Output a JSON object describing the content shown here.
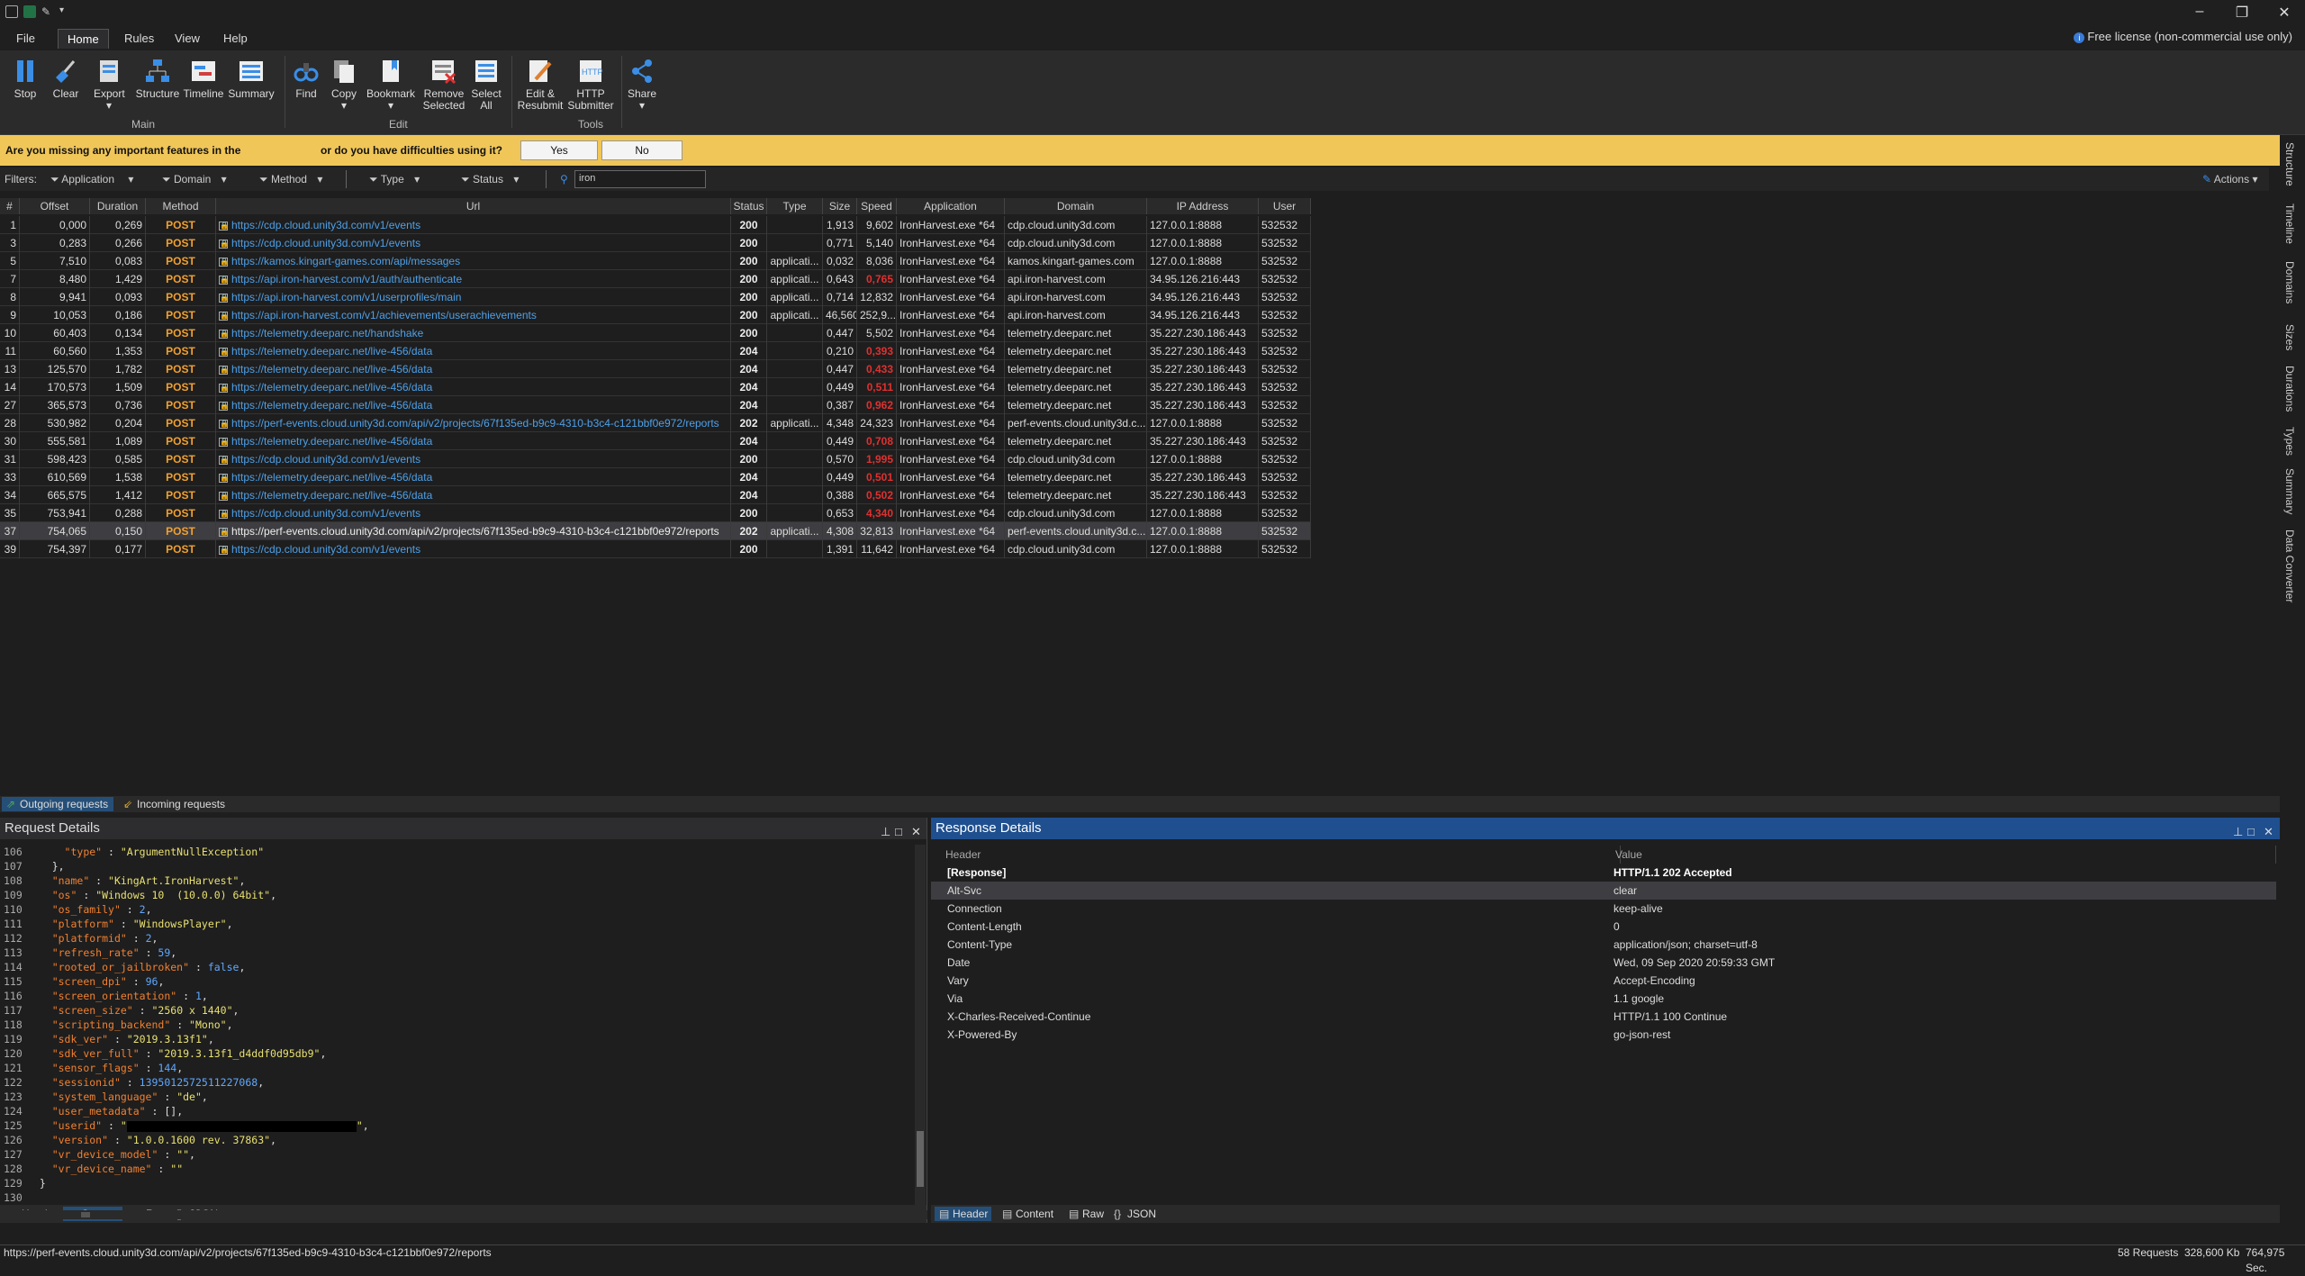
{
  "menu": {
    "file": "File",
    "home": "Home",
    "rules": "Rules",
    "view": "View",
    "help": "Help",
    "license": "Free license (non-commercial use only)"
  },
  "ribbon": {
    "stop": "Stop",
    "clear": "Clear",
    "export": "Export",
    "structure": "Structure",
    "timeline": "Timeline",
    "summary": "Summary",
    "find": "Find",
    "copy": "Copy",
    "bookmark": "Bookmark",
    "remove_selected_1": "Remove",
    "remove_selected_2": "Selected",
    "select_all_1": "Select",
    "select_all_2": "All",
    "edit_resubmit_1": "Edit &",
    "edit_resubmit_2": "Resubmit",
    "http_submitter_1": "HTTP",
    "http_submitter_2": "Submitter",
    "share": "Share",
    "group_main": "Main",
    "group_edit": "Edit",
    "group_tools": "Tools"
  },
  "banner": {
    "msg1": "Are you missing any important features in the",
    "msg2": "or do you have difficulties using it?",
    "yes": "Yes",
    "no": "No"
  },
  "filters": {
    "label": "Filters:",
    "application": "Application",
    "domain": "Domain",
    "method": "Method",
    "type": "Type",
    "status": "Status",
    "search_value": "iron",
    "actions": "Actions"
  },
  "grid": {
    "columns": [
      "#",
      "Offset",
      "Duration",
      "Method",
      "Url",
      "Status",
      "Type",
      "Size",
      "Speed",
      "Application",
      "Domain",
      "IP Address",
      "User"
    ],
    "rows": [
      [
        "1",
        "0,000",
        "0,269",
        "POST",
        "https://cdp.cloud.unity3d.com/v1/events",
        "200",
        "",
        "1,913",
        "9,602",
        "IronHarvest.exe *64",
        "cdp.cloud.unity3d.com",
        "127.0.0.1:8888",
        "532532"
      ],
      [
        "3",
        "0,283",
        "0,266",
        "POST",
        "https://cdp.cloud.unity3d.com/v1/events",
        "200",
        "",
        "0,771",
        "5,140",
        "IronHarvest.exe *64",
        "cdp.cloud.unity3d.com",
        "127.0.0.1:8888",
        "532532"
      ],
      [
        "5",
        "7,510",
        "0,083",
        "POST",
        "https://kamos.kingart-games.com/api/messages",
        "200",
        "applicati...",
        "0,032",
        "8,036",
        "IronHarvest.exe *64",
        "kamos.kingart-games.com",
        "127.0.0.1:8888",
        "532532"
      ],
      [
        "7",
        "8,480",
        "1,429",
        "POST",
        "https://api.iron-harvest.com/v1/auth/authenticate",
        "200",
        "applicati...",
        "0,643",
        "0,765",
        "IronHarvest.exe *64",
        "api.iron-harvest.com",
        "34.95.126.216:443",
        "532532"
      ],
      [
        "8",
        "9,941",
        "0,093",
        "POST",
        "https://api.iron-harvest.com/v1/userprofiles/main",
        "200",
        "applicati...",
        "0,714",
        "12,832",
        "IronHarvest.exe *64",
        "api.iron-harvest.com",
        "34.95.126.216:443",
        "532532"
      ],
      [
        "9",
        "10,053",
        "0,186",
        "POST",
        "https://api.iron-harvest.com/v1/achievements/userachievements",
        "200",
        "applicati...",
        "46,560",
        "252,9...",
        "IronHarvest.exe *64",
        "api.iron-harvest.com",
        "34.95.126.216:443",
        "532532"
      ],
      [
        "10",
        "60,403",
        "0,134",
        "POST",
        "https://telemetry.deeparc.net/handshake",
        "200",
        "",
        "0,447",
        "5,502",
        "IronHarvest.exe *64",
        "telemetry.deeparc.net",
        "35.227.230.186:443",
        "532532"
      ],
      [
        "11",
        "60,560",
        "1,353",
        "POST",
        "https://telemetry.deeparc.net/live-456/data",
        "204",
        "",
        "0,210",
        "0,393",
        "IronHarvest.exe *64",
        "telemetry.deeparc.net",
        "35.227.230.186:443",
        "532532"
      ],
      [
        "13",
        "125,570",
        "1,782",
        "POST",
        "https://telemetry.deeparc.net/live-456/data",
        "204",
        "",
        "0,447",
        "0,433",
        "IronHarvest.exe *64",
        "telemetry.deeparc.net",
        "35.227.230.186:443",
        "532532"
      ],
      [
        "14",
        "170,573",
        "1,509",
        "POST",
        "https://telemetry.deeparc.net/live-456/data",
        "204",
        "",
        "0,449",
        "0,511",
        "IronHarvest.exe *64",
        "telemetry.deeparc.net",
        "35.227.230.186:443",
        "532532"
      ],
      [
        "27",
        "365,573",
        "0,736",
        "POST",
        "https://telemetry.deeparc.net/live-456/data",
        "204",
        "",
        "0,387",
        "0,962",
        "IronHarvest.exe *64",
        "telemetry.deeparc.net",
        "35.227.230.186:443",
        "532532"
      ],
      [
        "28",
        "530,982",
        "0,204",
        "POST",
        "https://perf-events.cloud.unity3d.com/api/v2/projects/67f135ed-b9c9-4310-b3c4-c121bbf0e972/reports",
        "202",
        "applicati...",
        "4,348",
        "24,323",
        "IronHarvest.exe *64",
        "perf-events.cloud.unity3d.c...",
        "127.0.0.1:8888",
        "532532"
      ],
      [
        "30",
        "555,581",
        "1,089",
        "POST",
        "https://telemetry.deeparc.net/live-456/data",
        "204",
        "",
        "0,449",
        "0,708",
        "IronHarvest.exe *64",
        "telemetry.deeparc.net",
        "35.227.230.186:443",
        "532532"
      ],
      [
        "31",
        "598,423",
        "0,585",
        "POST",
        "https://cdp.cloud.unity3d.com/v1/events",
        "200",
        "",
        "0,570",
        "1,995",
        "IronHarvest.exe *64",
        "cdp.cloud.unity3d.com",
        "127.0.0.1:8888",
        "532532"
      ],
      [
        "33",
        "610,569",
        "1,538",
        "POST",
        "https://telemetry.deeparc.net/live-456/data",
        "204",
        "",
        "0,449",
        "0,501",
        "IronHarvest.exe *64",
        "telemetry.deeparc.net",
        "35.227.230.186:443",
        "532532"
      ],
      [
        "34",
        "665,575",
        "1,412",
        "POST",
        "https://telemetry.deeparc.net/live-456/data",
        "204",
        "",
        "0,388",
        "0,502",
        "IronHarvest.exe *64",
        "telemetry.deeparc.net",
        "35.227.230.186:443",
        "532532"
      ],
      [
        "35",
        "753,941",
        "0,288",
        "POST",
        "https://cdp.cloud.unity3d.com/v1/events",
        "200",
        "",
        "0,653",
        "4,340",
        "IronHarvest.exe *64",
        "cdp.cloud.unity3d.com",
        "127.0.0.1:8888",
        "532532"
      ],
      [
        "37",
        "754,065",
        "0,150",
        "POST",
        "https://perf-events.cloud.unity3d.com/api/v2/projects/67f135ed-b9c9-4310-b3c4-c121bbf0e972/reports",
        "202",
        "applicati...",
        "4,308",
        "32,813",
        "IronHarvest.exe *64",
        "perf-events.cloud.unity3d.c...",
        "127.0.0.1:8888",
        "532532"
      ],
      [
        "39",
        "754,397",
        "0,177",
        "POST",
        "https://cdp.cloud.unity3d.com/v1/events",
        "200",
        "",
        "1,391",
        "11,642",
        "IronHarvest.exe *64",
        "cdp.cloud.unity3d.com",
        "127.0.0.1:8888",
        "532532"
      ]
    ],
    "slow_rows": [
      3,
      7,
      8,
      9,
      10,
      12,
      13,
      14,
      15,
      16
    ],
    "selected_row": 17
  },
  "sidebar": [
    "Structure",
    "Timeline",
    "Domains",
    "Sizes",
    "Durations",
    "Types",
    "Summary",
    "Data Converter"
  ],
  "bottom_tabs": {
    "outgoing": "Outgoing requests",
    "incoming": "Incoming requests"
  },
  "request": {
    "title": "Request Details",
    "lines": [
      {
        "n": "106",
        "ind": "      ",
        "key": "\"type\"",
        "val": "\"ArgumentNullException\"",
        "t": "s",
        "tail": ""
      },
      {
        "n": "107",
        "ind": "    ",
        "raw": "},"
      },
      {
        "n": "108",
        "ind": "    ",
        "key": "\"name\"",
        "val": "\"KingArt.IronHarvest\"",
        "t": "s",
        "tail": ","
      },
      {
        "n": "109",
        "ind": "    ",
        "key": "\"os\"",
        "val": "\"Windows 10  (10.0.0) 64bit\"",
        "t": "s",
        "tail": ","
      },
      {
        "n": "110",
        "ind": "    ",
        "key": "\"os_family\"",
        "val": "2",
        "t": "n",
        "tail": ","
      },
      {
        "n": "111",
        "ind": "    ",
        "key": "\"platform\"",
        "val": "\"WindowsPlayer\"",
        "t": "s",
        "tail": ","
      },
      {
        "n": "112",
        "ind": "    ",
        "key": "\"platformid\"",
        "val": "2",
        "t": "n",
        "tail": ","
      },
      {
        "n": "113",
        "ind": "    ",
        "key": "\"refresh_rate\"",
        "val": "59",
        "t": "n",
        "tail": ","
      },
      {
        "n": "114",
        "ind": "    ",
        "key": "\"rooted_or_jailbroken\"",
        "val": "false",
        "t": "b",
        "tail": ","
      },
      {
        "n": "115",
        "ind": "    ",
        "key": "\"screen_dpi\"",
        "val": "96",
        "t": "n",
        "tail": ","
      },
      {
        "n": "116",
        "ind": "    ",
        "key": "\"screen_orientation\"",
        "val": "1",
        "t": "n",
        "tail": ","
      },
      {
        "n": "117",
        "ind": "    ",
        "key": "\"screen_size\"",
        "val": "\"2560 x 1440\"",
        "t": "s",
        "tail": ","
      },
      {
        "n": "118",
        "ind": "    ",
        "key": "\"scripting_backend\"",
        "val": "\"Mono\"",
        "t": "s",
        "tail": ","
      },
      {
        "n": "119",
        "ind": "    ",
        "key": "\"sdk_ver\"",
        "val": "\"2019.3.13f1\"",
        "t": "s",
        "tail": ","
      },
      {
        "n": "120",
        "ind": "    ",
        "key": "\"sdk_ver_full\"",
        "val": "\"2019.3.13f1_d4ddf0d95db9\"",
        "t": "s",
        "tail": ","
      },
      {
        "n": "121",
        "ind": "    ",
        "key": "\"sensor_flags\"",
        "val": "144",
        "t": "n",
        "tail": ","
      },
      {
        "n": "122",
        "ind": "    ",
        "key": "\"sessionid\"",
        "val": "1395012572511227068",
        "t": "n",
        "tail": ","
      },
      {
        "n": "123",
        "ind": "    ",
        "key": "\"system_language\"",
        "val": "\"de\"",
        "t": "s",
        "tail": ","
      },
      {
        "n": "124",
        "ind": "    ",
        "key": "\"user_metadata\"",
        "val": "[]",
        "t": "p",
        "tail": ","
      },
      {
        "n": "125",
        "ind": "    ",
        "key": "\"userid\"",
        "val": "REDACT",
        "t": "r",
        "tail": ","
      },
      {
        "n": "126",
        "ind": "    ",
        "key": "\"version\"",
        "val": "\"1.0.0.1600 rev. 37863\"",
        "t": "s",
        "tail": ","
      },
      {
        "n": "127",
        "ind": "    ",
        "key": "\"vr_device_model\"",
        "val": "\"\"",
        "t": "s",
        "tail": ","
      },
      {
        "n": "128",
        "ind": "    ",
        "key": "\"vr_device_name\"",
        "val": "\"\"",
        "t": "s",
        "tail": ""
      },
      {
        "n": "129",
        "ind": "  ",
        "raw": "}"
      },
      {
        "n": "130",
        "ind": "",
        "raw": ""
      }
    ]
  },
  "response": {
    "title": "Response Details",
    "col_header": "Header",
    "col_value": "Value",
    "rows": [
      {
        "h": "[Response]",
        "v": "HTTP/1.1 202 Accepted",
        "bold": true
      },
      {
        "h": "Alt-Svc",
        "v": "clear",
        "sel": true
      },
      {
        "h": "Connection",
        "v": "keep-alive"
      },
      {
        "h": "Content-Length",
        "v": "0"
      },
      {
        "h": "Content-Type",
        "v": "application/json; charset=utf-8"
      },
      {
        "h": "Date",
        "v": "Wed, 09 Sep 2020 20:59:33 GMT"
      },
      {
        "h": "Vary",
        "v": "Accept-Encoding"
      },
      {
        "h": "Via",
        "v": "1.1 google"
      },
      {
        "h": "X-Charles-Received-Continue",
        "v": "HTTP/1.1 100 Continue"
      },
      {
        "h": "X-Powered-By",
        "v": "go-json-rest"
      }
    ]
  },
  "subtabs": {
    "header": "Header",
    "content": "Content",
    "raw": "Raw",
    "json": "JSON"
  },
  "status": {
    "url": "https://perf-events.cloud.unity3d.com/api/v2/projects/67f135ed-b9c9-4310-b3c4-c121bbf0e972/reports",
    "requests": "58 Requests",
    "size": "328,600 Kb",
    "speed": "764,975 Sec."
  }
}
